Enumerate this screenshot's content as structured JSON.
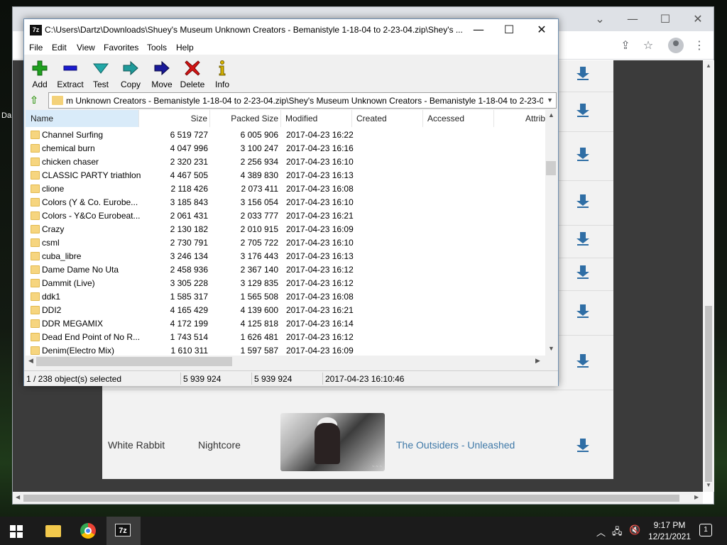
{
  "desktop": {
    "label_fragment": "Da"
  },
  "browser": {
    "rows": [
      {
        "artist": "White Rabbit",
        "genre": "Nightcore",
        "album": "The Outsiders - Unleashed"
      }
    ],
    "partial_date": "2-23-04",
    "link_color": "#3f79a8",
    "download_icon": "download-arrow"
  },
  "sevenzip": {
    "app_icon_text": "7z",
    "title": "C:\\Users\\Dartz\\Downloads\\Shuey's Museum Unknown Creators - Bemanistyle 1-18-04 to 2-23-04.zip\\Shey's ...",
    "menu": [
      "File",
      "Edit",
      "View",
      "Favorites",
      "Tools",
      "Help"
    ],
    "toolbar": {
      "add": "Add",
      "extract": "Extract",
      "test": "Test",
      "copy": "Copy",
      "move": "Move",
      "delete": "Delete",
      "info": "Info"
    },
    "address": "m Unknown Creators - Bemanistyle 1-18-04 to 2-23-04.zip\\Shey's Museum Unknown Creators - Bemanistyle 1-18-04 to 2-23-04\\",
    "columns": {
      "name": "Name",
      "size": "Size",
      "packed": "Packed Size",
      "modified": "Modified",
      "created": "Created",
      "accessed": "Accessed",
      "attrib": "Attrib"
    },
    "files": [
      {
        "name": "Channel Surfing",
        "size": "6 519 727",
        "packed": "6 005 906",
        "modified": "2017-04-23 16:22"
      },
      {
        "name": "chemical burn",
        "size": "4 047 996",
        "packed": "3 100 247",
        "modified": "2017-04-23 16:16"
      },
      {
        "name": "chicken chaser",
        "size": "2 320 231",
        "packed": "2 256 934",
        "modified": "2017-04-23 16:10"
      },
      {
        "name": "CLASSIC PARTY triathlon",
        "size": "4 467 505",
        "packed": "4 389 830",
        "modified": "2017-04-23 16:13"
      },
      {
        "name": "clione",
        "size": "2 118 426",
        "packed": "2 073 411",
        "modified": "2017-04-23 16:08"
      },
      {
        "name": "Colors (Y & Co. Eurobe...",
        "size": "3 185 843",
        "packed": "3 156 054",
        "modified": "2017-04-23 16:10"
      },
      {
        "name": "Colors - Y&Co Eurobeat...",
        "size": "2 061 431",
        "packed": "2 033 777",
        "modified": "2017-04-23 16:21"
      },
      {
        "name": "Crazy",
        "size": "2 130 182",
        "packed": "2 010 915",
        "modified": "2017-04-23 16:09"
      },
      {
        "name": "csml",
        "size": "2 730 791",
        "packed": "2 705 722",
        "modified": "2017-04-23 16:10"
      },
      {
        "name": "cuba_libre",
        "size": "3 246 134",
        "packed": "3 176 443",
        "modified": "2017-04-23 16:13"
      },
      {
        "name": "Dame Dame No Uta",
        "size": "2 458 936",
        "packed": "2 367 140",
        "modified": "2017-04-23 16:12"
      },
      {
        "name": "Dammit (Live)",
        "size": "3 305 228",
        "packed": "3 129 835",
        "modified": "2017-04-23 16:12"
      },
      {
        "name": "ddk1",
        "size": "1 585 317",
        "packed": "1 565 508",
        "modified": "2017-04-23 16:08"
      },
      {
        "name": "DDI2",
        "size": "4 165 429",
        "packed": "4 139 600",
        "modified": "2017-04-23 16:21"
      },
      {
        "name": "DDR MEGAMIX",
        "size": "4 172 199",
        "packed": "4 125 818",
        "modified": "2017-04-23 16:14"
      },
      {
        "name": "Dead End Point of No R...",
        "size": "1 743 514",
        "packed": "1 626 481",
        "modified": "2017-04-23 16:12"
      },
      {
        "name": "Denim(Electro Mix)",
        "size": "1 610 311",
        "packed": "1 597 587",
        "modified": "2017-04-23 16:09"
      }
    ],
    "status": {
      "selection": "1 / 238 object(s) selected",
      "size": "5 939 924",
      "packed": "5 939 924",
      "modified": "2017-04-23 16:10:46"
    },
    "colors": {
      "add": "#1fa01f",
      "extract": "#1a1ad0",
      "test": "#22a7a7",
      "copy": "#1f9a9a",
      "move": "#1a1a9a",
      "delete": "#d41414",
      "info": "#d8b400"
    }
  },
  "taskbar": {
    "time": "9:17 PM",
    "date": "12/21/2021",
    "notifications": "1"
  }
}
